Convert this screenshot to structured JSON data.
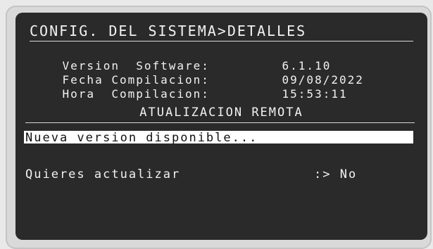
{
  "screen": {
    "title": "CONFIG. DEL SISTEMA>DETALLES",
    "info": [
      {
        "label": "Version  Software:",
        "value": "6.1.10"
      },
      {
        "label": "Fecha Compilacion:",
        "value": "09/08/2022"
      },
      {
        "label": "Hora  Compilacion:",
        "value": "15:53:11"
      }
    ],
    "section_title": "ATUALIZACION REMOTA",
    "banner": "Nueva version disponible...",
    "question": "Quieres actualizar",
    "answer_prefix": ":>",
    "answer": "No"
  }
}
